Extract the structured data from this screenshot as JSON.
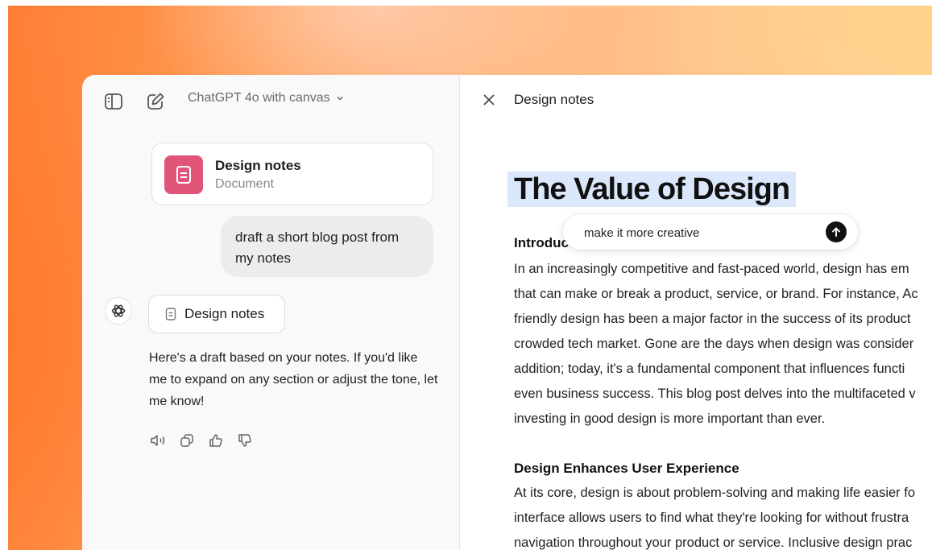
{
  "header": {
    "model_label": "ChatGPT 4o with canvas",
    "icons": {
      "sidebar": "sidebar-toggle-icon",
      "new_chat": "new-chat-icon",
      "chevron": "chevron-down-icon"
    }
  },
  "chat": {
    "doc_card": {
      "title": "Design notes",
      "subtitle": "Document",
      "icon": "document-icon",
      "color": "#e2557a"
    },
    "user_message": "draft a short blog post from my notes",
    "assistant": {
      "chip_label": "Design notes",
      "text": "Here's a draft based on your notes. If you'd like me to expand on any section or adjust the tone, let me know!",
      "actions": [
        "speaker-icon",
        "copy-icon",
        "thumbs-up-icon",
        "thumbs-down-icon"
      ]
    }
  },
  "canvas": {
    "title": "Design notes",
    "doc_title": "The Value of Design",
    "edit_prompt": {
      "value": "make it more creative"
    },
    "sections": [
      {
        "heading": "Introduc",
        "lines": [
          "In an increasingly competitive and fast-paced world, design has em",
          "that can make or break a product, service, or brand. For instance, Ac",
          "friendly design has been a major factor in the success of its product",
          "crowded tech market. Gone are the days when design was consider",
          "addition; today, it's a fundamental component that influences functi",
          "even business success. This blog post delves into the multifaceted v",
          "investing in good design is more important than ever."
        ]
      },
      {
        "heading": "Design Enhances User Experience",
        "lines": [
          "At its core, design is about problem-solving and making life easier fo",
          "interface allows users to find what they're looking for without frustra",
          "navigation throughout your product or service. Inclusive design prac"
        ]
      }
    ]
  },
  "colors": {
    "highlight": "#dbe7fb",
    "accent": "#e2557a"
  }
}
